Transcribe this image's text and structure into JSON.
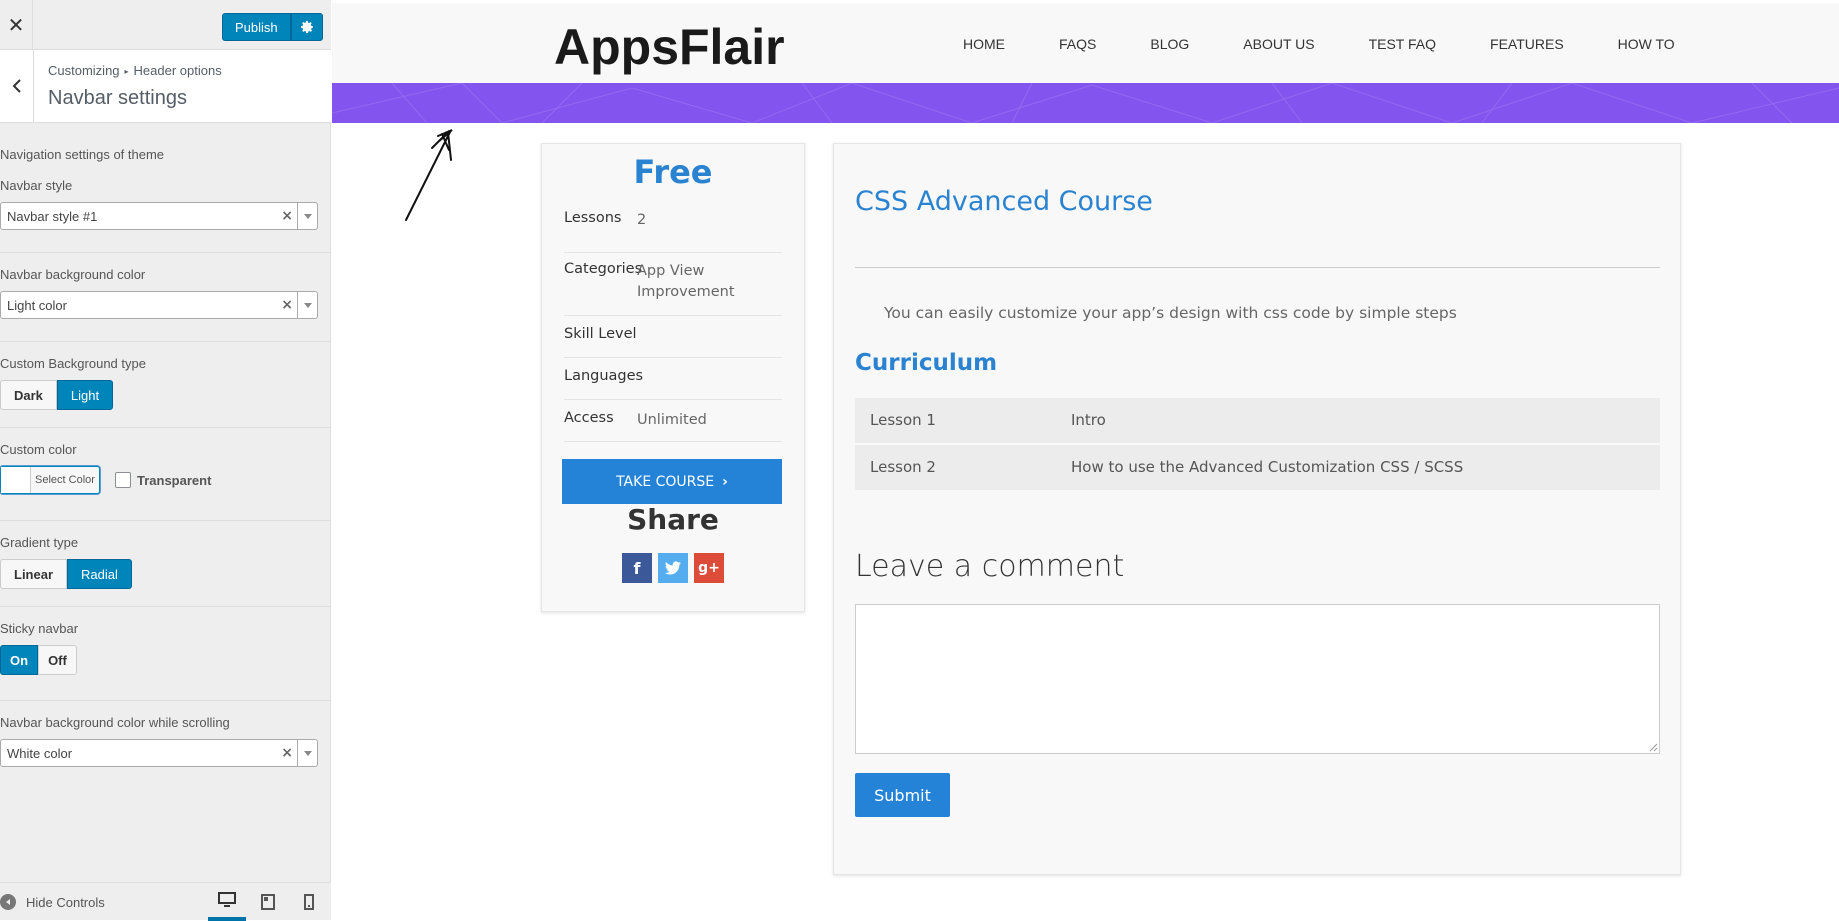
{
  "customizer": {
    "close_icon": "close-icon",
    "publish_label": "Publish",
    "breadcrumb": [
      "Customizing",
      "Header options"
    ],
    "section_title": "Navbar settings",
    "description": "Navigation settings of theme",
    "navbar_style": {
      "label": "Navbar style",
      "value": "Navbar style #1"
    },
    "navbar_bg_color": {
      "label": "Navbar background color",
      "value": "Light color"
    },
    "custom_bg_type": {
      "label": "Custom Background type",
      "options": [
        "Dark",
        "Light"
      ],
      "selected": "Light"
    },
    "custom_color": {
      "label": "Custom color",
      "picker_label": "Select Color",
      "transparent_label": "Transparent"
    },
    "gradient_type": {
      "label": "Gradient type",
      "options": [
        "Linear",
        "Radial"
      ],
      "selected": "Radial"
    },
    "sticky_navbar": {
      "label": "Sticky navbar",
      "options": [
        "On",
        "Off"
      ],
      "selected": "On"
    },
    "navbar_scroll_color": {
      "label": "Navbar background color while scrolling",
      "value": "White color"
    },
    "footer": {
      "hide_controls": "Hide Controls",
      "devices": [
        "desktop-icon",
        "tablet-icon",
        "mobile-icon"
      ]
    },
    "accent": "#0085ba"
  },
  "site": {
    "logo": "AppsFlair",
    "menu": [
      "HOME",
      "FAQS",
      "BLOG",
      "ABOUT US",
      "TEST FAQ",
      "FEATURES",
      "HOW TO"
    ],
    "banner_color": "#8454ef"
  },
  "course_sidebar": {
    "price": "Free",
    "info": [
      {
        "key": "Lessons",
        "value": "2"
      },
      {
        "key": "Categories",
        "value": "App View Improvement"
      },
      {
        "key": "Skill Level",
        "value": ""
      },
      {
        "key": "Languages",
        "value": ""
      },
      {
        "key": "Access",
        "value": "Unlimited"
      }
    ],
    "take_course": "TAKE COURSE",
    "share_title": "Share",
    "share_icons": [
      "facebook-icon",
      "twitter-icon",
      "google-plus-icon"
    ]
  },
  "course": {
    "title": "CSS Advanced Course",
    "description": "You can easily customize your app’s design with css code by simple steps",
    "curriculum_title": "Curriculum",
    "lessons": [
      {
        "number": "Lesson 1",
        "title": "Intro"
      },
      {
        "number": "Lesson 2",
        "title": "How to use the Advanced Customization CSS / SCSS"
      }
    ],
    "comment_heading": "Leave a comment",
    "submit_label": "Submit",
    "primary_color": "#2a83d1"
  }
}
